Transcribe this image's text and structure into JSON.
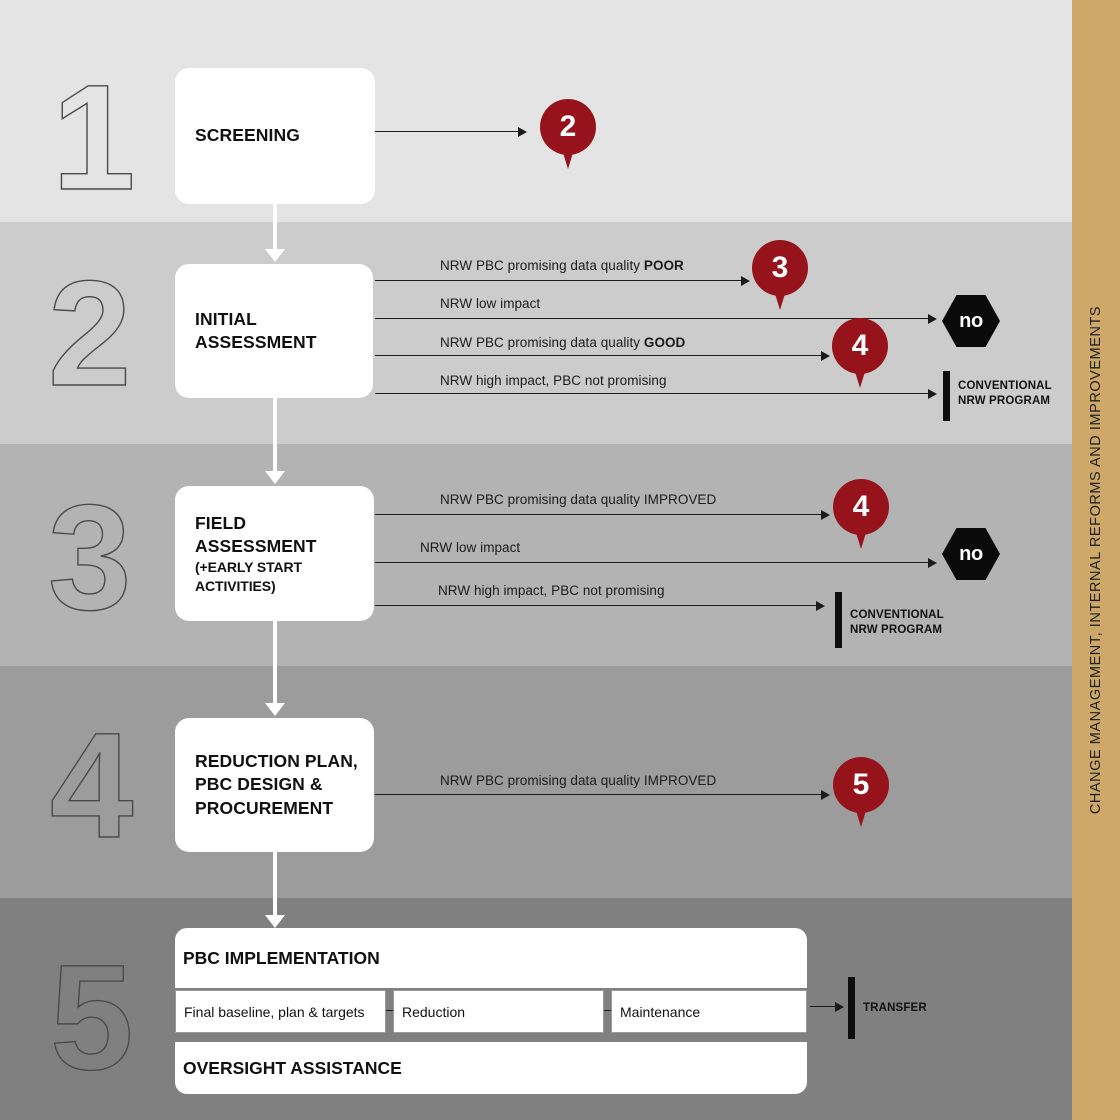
{
  "side_strip": {
    "label": "CHANGE MANAGEMENT, INTERNAL REFORMS AND IMPROVEMENTS",
    "color": "#cda868"
  },
  "colors": {
    "marker_red": "#96131b",
    "terminator_black": "#0d0d0d",
    "band_1": "#e4e4e4",
    "band_2": "#cccccc",
    "band_3": "#b3b3b3",
    "band_4": "#9c9c9c",
    "band_5": "#808080"
  },
  "steps": {
    "one": "1",
    "two": "2",
    "three": "3",
    "four": "4",
    "five": "5"
  },
  "phase1": {
    "box_title": "SCREENING",
    "outcome_pin": "2"
  },
  "phase2": {
    "box_title": "INITIAL\nASSESSMENT",
    "box_title_line1": "INITIAL",
    "box_title_line2": "ASSESSMENT",
    "branches": [
      {
        "label_plain": "NRW PBC promising data quality ",
        "label_bold": "POOR",
        "target": "3"
      },
      {
        "label_plain": "NRW low impact",
        "label_bold": "",
        "target": "no"
      },
      {
        "label_plain": "NRW PBC promising data quality ",
        "label_bold": "GOOD",
        "target": "4"
      },
      {
        "label_plain": "NRW high impact, PBC not promising",
        "label_bold": "",
        "target": "CONVENTIONAL NRW PROGRAM"
      }
    ],
    "pin_3": "3",
    "pin_4": "4",
    "hex_no": "no",
    "terminator_label": "CONVENTIONAL\nNRW PROGRAM"
  },
  "phase3": {
    "box_title_line1": "FIELD",
    "box_title_line2": "ASSESSMENT",
    "box_subtitle": "(+EARLY START ACTIVITIES)",
    "branches": [
      {
        "label": "NRW PBC promising data quality IMPROVED",
        "target": "4"
      },
      {
        "label": "NRW low impact",
        "target": "no"
      },
      {
        "label": "NRW high impact, PBC not promising",
        "target": "CONVENTIONAL NRW PROGRAM"
      }
    ],
    "pin_4": "4",
    "hex_no": "no",
    "terminator_label": "CONVENTIONAL\nNRW PROGRAM"
  },
  "phase4": {
    "box_title_line1": "REDUCTION PLAN,",
    "box_title_line2": "PBC DESIGN &",
    "box_title_line3": "PROCUREMENT",
    "branch_label": "NRW PBC promising data quality IMPROVED",
    "pin_5": "5"
  },
  "phase5": {
    "implementation_title": "PBC IMPLEMENTATION",
    "oversight_title": "OVERSIGHT ASSISTANCE",
    "stages": [
      "Final baseline, plan & targets",
      "Reduction",
      "Maintenance"
    ],
    "terminator_label": "TRANSFER"
  }
}
